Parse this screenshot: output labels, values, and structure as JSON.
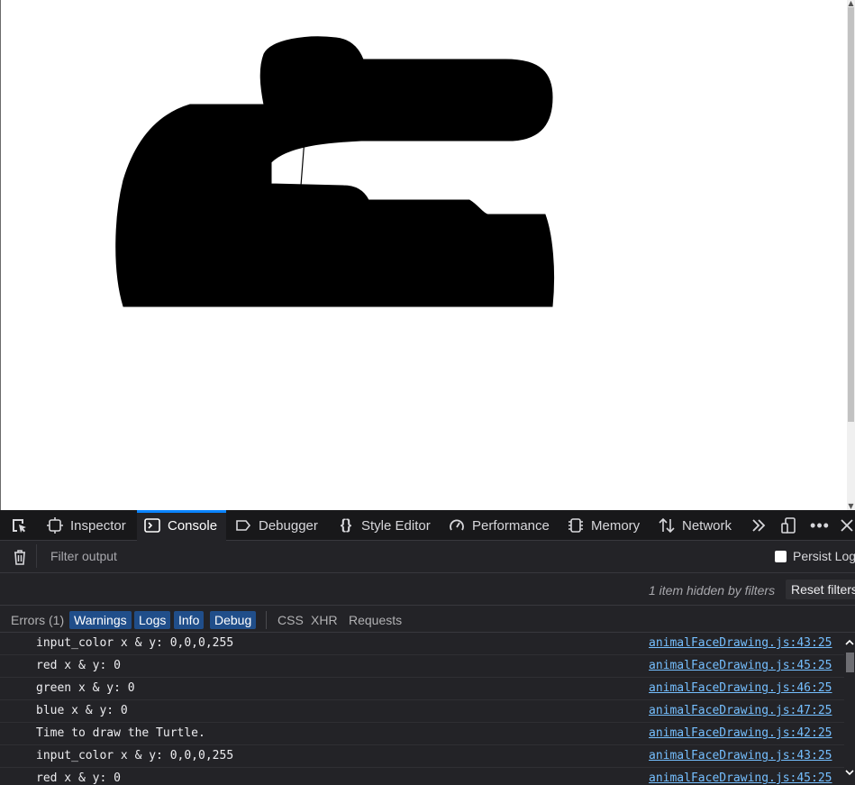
{
  "devtools": {
    "tabs": [
      {
        "label": "Inspector"
      },
      {
        "label": "Console"
      },
      {
        "label": "Debugger"
      },
      {
        "label": "Style Editor"
      },
      {
        "label": "Performance"
      },
      {
        "label": "Memory"
      },
      {
        "label": "Network"
      }
    ],
    "selected_tab": "Console",
    "filter_placeholder": "Filter output",
    "persist_logs_label": "Persist Logs",
    "persist_logs_checked": false,
    "hidden_notice": "1 item hidden by filters",
    "reset_filters_label": "Reset filters",
    "levels": [
      {
        "label": "Errors (1)",
        "active": false
      },
      {
        "label": "Warnings",
        "active": true
      },
      {
        "label": "Logs",
        "active": true
      },
      {
        "label": "Info",
        "active": true
      },
      {
        "label": "Debug",
        "active": true
      }
    ],
    "types": [
      "CSS",
      "XHR",
      "Requests"
    ],
    "messages": [
      {
        "text": "input_color x & y: 0,0,0,255",
        "source": "animalFaceDrawing.js:43:25"
      },
      {
        "text": "red x & y: 0",
        "source": "animalFaceDrawing.js:45:25"
      },
      {
        "text": "green x & y: 0",
        "source": "animalFaceDrawing.js:46:25"
      },
      {
        "text": "blue x & y: 0",
        "source": "animalFaceDrawing.js:47:25"
      },
      {
        "text": "Time to draw the Turtle.",
        "source": "animalFaceDrawing.js:42:25"
      },
      {
        "text": "input_color x & y: 0,0,0,255",
        "source": "animalFaceDrawing.js:43:25"
      },
      {
        "text": "red x & y: 0",
        "source": "animalFaceDrawing.js:45:25"
      }
    ]
  },
  "colors": {
    "toolbar_bg": "#18181a",
    "panel_bg": "#232327",
    "accent": "#0a84ff",
    "active_filter_bg": "#204e8a",
    "link": "#75bfff",
    "drawing_fill": "#000000"
  }
}
